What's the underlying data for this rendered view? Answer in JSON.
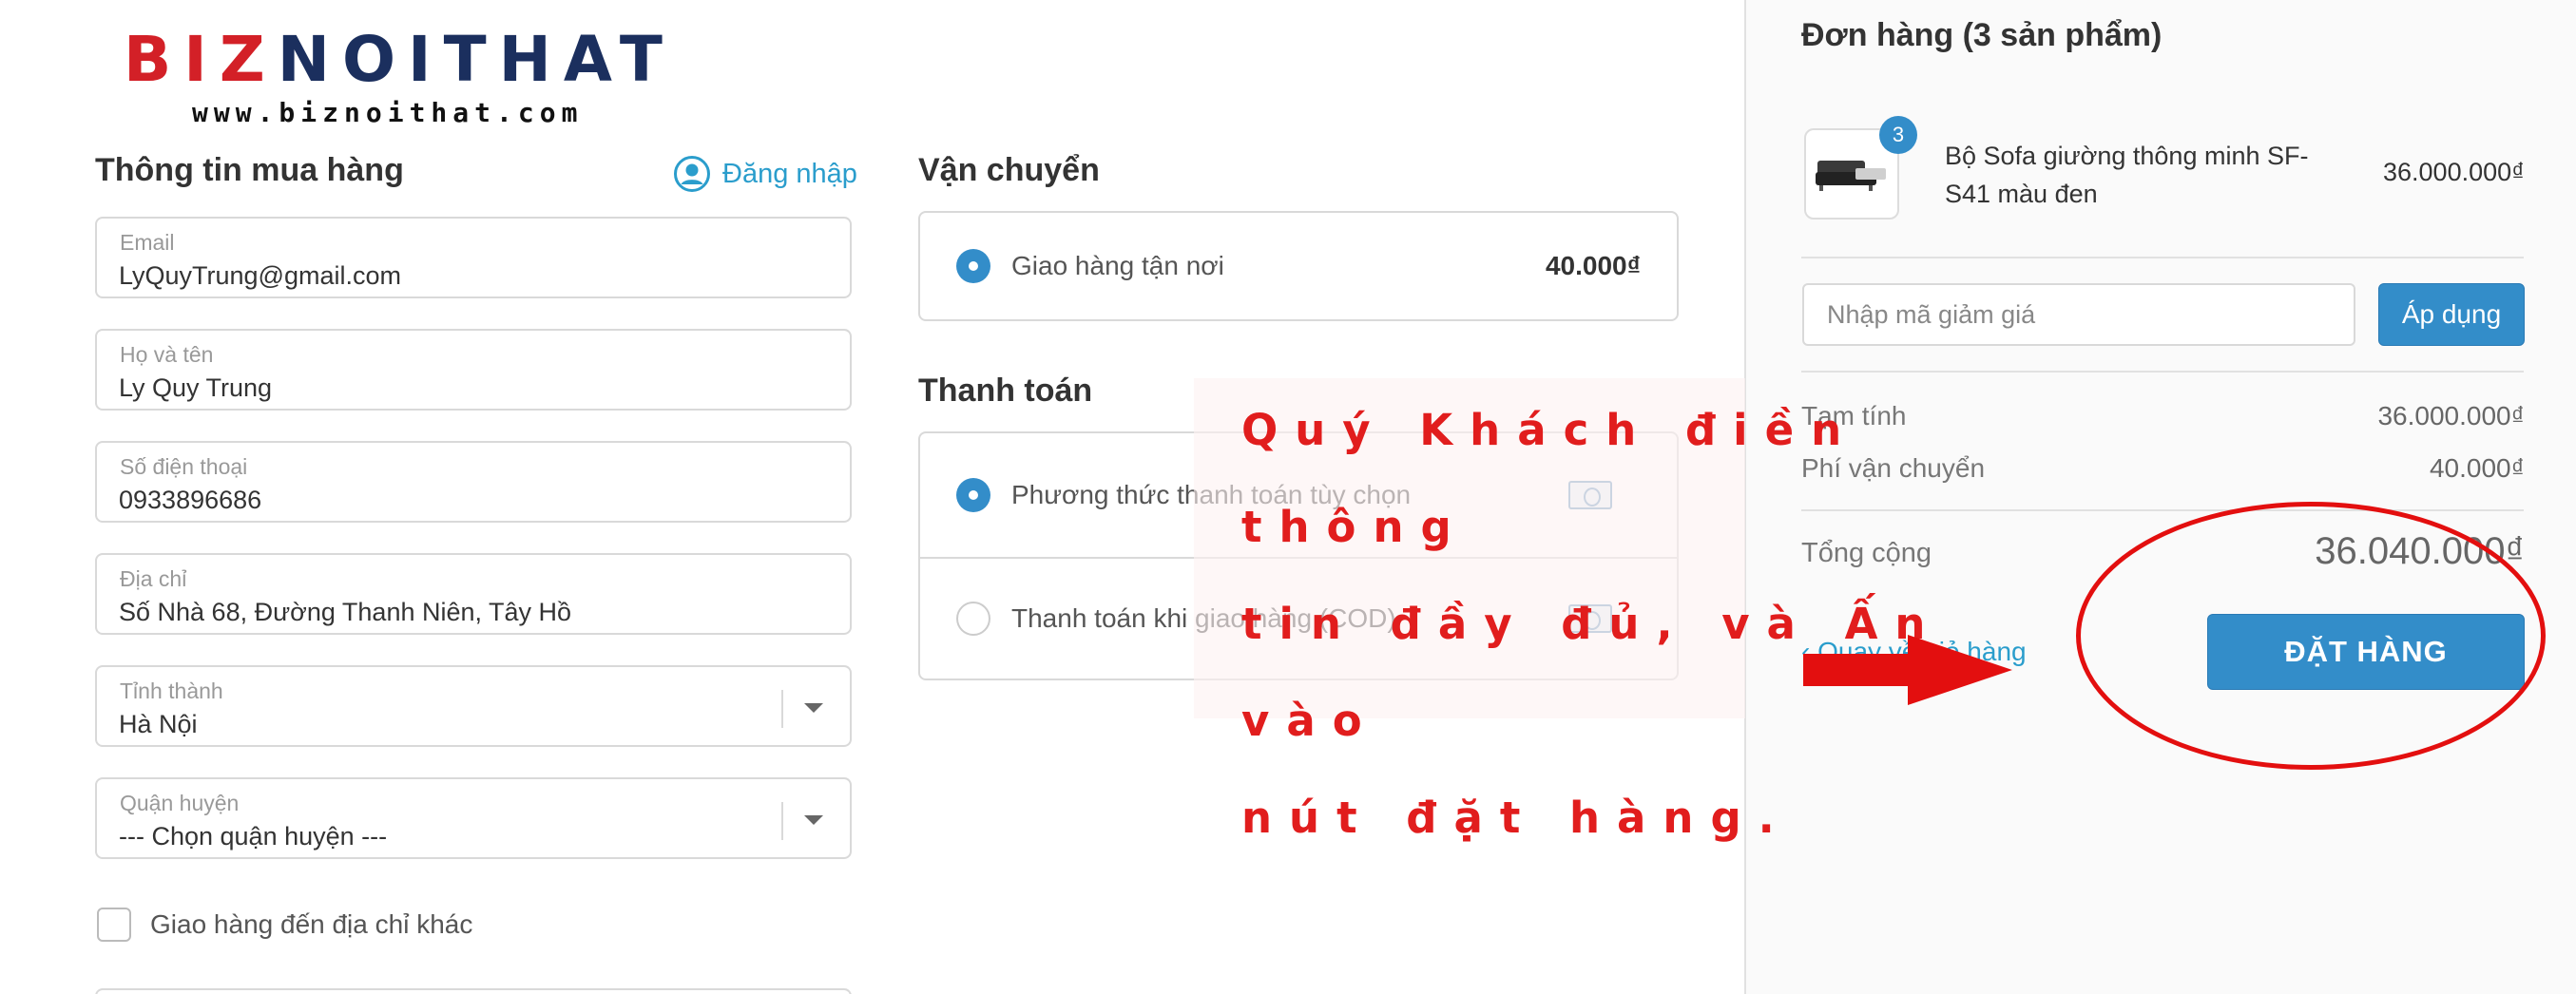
{
  "logo": {
    "part1": "BIZ",
    "part2": "NOITHAT",
    "url": "www.biznoithat.com"
  },
  "customer": {
    "title": "Thông tin mua hàng",
    "login_label": "Đăng nhập",
    "fields": [
      {
        "label": "Email",
        "value": "LyQuyTrung@gmail.com"
      },
      {
        "label": "Họ và tên",
        "value": "Ly Quy Trung"
      },
      {
        "label": "Số điện thoại",
        "value": "0933896686"
      },
      {
        "label": "Địa chỉ",
        "value": "Số Nhà 68, Đường Thanh Niên, Tây Hồ"
      },
      {
        "label": "Tỉnh thành",
        "value": "Hà Nội"
      },
      {
        "label": "Quận huyện",
        "value": "--- Chọn quận huyện ---"
      }
    ],
    "alt_address_label": "Giao hàng đến địa chỉ khác"
  },
  "shipping": {
    "title": "Vận chuyển",
    "option": {
      "label": "Giao hàng tận nơi",
      "price": "40.000₫"
    }
  },
  "payment": {
    "title": "Thanh toán",
    "options": [
      {
        "label": "Phương thức thanh toán tùy chọn",
        "selected": true
      },
      {
        "label": "Thanh toán khi giao hàng (COD)",
        "selected": false
      }
    ]
  },
  "order": {
    "title": "Đơn hàng (3 sản phẩm)",
    "item": {
      "quantity": "3",
      "name": "Bộ Sofa giường thông minh SF-S41 màu đen",
      "price": "36.000.000₫"
    },
    "discount_placeholder": "Nhập mã giảm giá",
    "apply_label": "Áp dụng",
    "subtotal_label": "Tạm tính",
    "subtotal_value": "36.000.000₫",
    "shipping_label": "Phí vận chuyển",
    "shipping_value": "40.000₫",
    "total_label": "Tổng cộng",
    "total_value": "36.040.000₫",
    "back_label": "‹ Quay về giỏ hàng",
    "submit_label": "ĐẶT HÀNG"
  },
  "instruction": {
    "lines": [
      "Quý Khách điền thông",
      "tin đầy đủ, và Ấn vào",
      "nút đặt hàng."
    ]
  },
  "colors": {
    "accent": "#338dc9",
    "link": "#2a9dcc",
    "annotation": "#e11d1d",
    "logo_red": "#d32027",
    "logo_navy": "#1b2f5e"
  }
}
